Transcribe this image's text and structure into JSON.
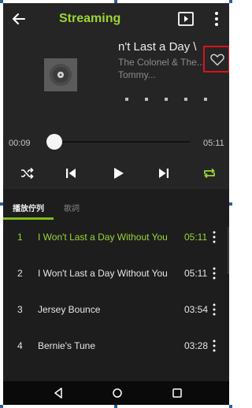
{
  "app_title": "Streaming",
  "now_playing": {
    "title": "n't Last a Day \\",
    "artist": "The Colonel & The... Tommy..."
  },
  "progress": {
    "elapsed": "00:09",
    "total": "05:11",
    "fraction": 0.03
  },
  "carousel": {
    "page_count": 5
  },
  "tabs": [
    {
      "label": "播放佇列"
    },
    {
      "label": "歌詞"
    }
  ],
  "tracks": [
    {
      "index": "1",
      "title": "I Won't Last a Day Without You",
      "duration": "05:11",
      "active": true
    },
    {
      "index": "2",
      "title": "I Won't Last a Day Without You",
      "duration": "05:11",
      "active": false
    },
    {
      "index": "3",
      "title": "Jersey Bounce",
      "duration": "03:54",
      "active": false
    },
    {
      "index": "4",
      "title": "Bernie's Tune",
      "duration": "03:28",
      "active": false
    }
  ],
  "icons": {
    "back": "arrow-left-icon",
    "cast": "cast-icon",
    "more": "more-vertical-icon",
    "favorite": "heart-outline-icon",
    "shuffle": "shuffle-icon",
    "previous": "skip-previous-icon",
    "play": "play-icon",
    "next": "skip-next-icon",
    "repeat": "repeat-icon",
    "nav_back": "nav-back-icon",
    "nav_home": "nav-home-icon",
    "nav_recents": "nav-recents-icon"
  },
  "colors": {
    "accent": "#9bd531",
    "background": "#1d1d1d",
    "player_background": "#252525",
    "highlight_box": "#d8141a"
  }
}
